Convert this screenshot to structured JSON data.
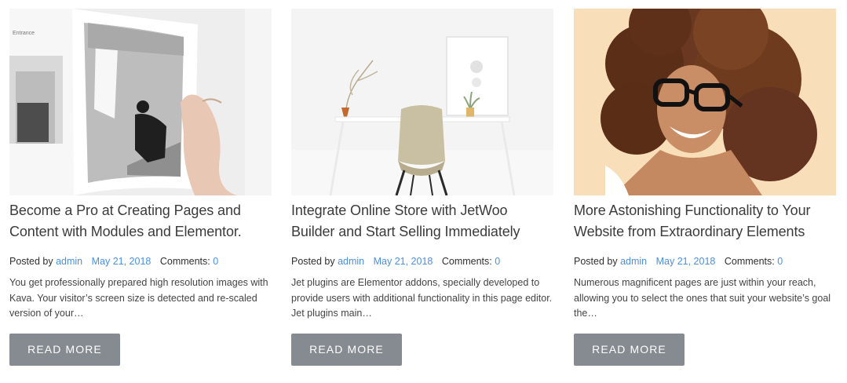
{
  "posts": [
    {
      "title": "Become a Pro at Creating Pages and Content with Modules and Elementor.",
      "posted_by_label": "Posted by",
      "author": "admin",
      "date": "May 21, 2018",
      "comments_label": "Comments:",
      "comments_count": "0",
      "excerpt": "You get professionally prepared high resolution images with Kava. Your visitor’s screen size is detected and re-scaled version of your…",
      "button_label": "READ MORE",
      "image_text": "Entrance"
    },
    {
      "title": "Integrate Online Store with JetWoo Builder and Start Selling Immediately",
      "posted_by_label": "Posted by",
      "author": "admin",
      "date": "May 21, 2018",
      "comments_label": "Comments:",
      "comments_count": "0",
      "excerpt": "Jet plugins are Elementor addons, specially developed to provide users with additional functionality in this page editor. Jet plugins main…",
      "button_label": "READ MORE"
    },
    {
      "title": "More Astonishing Functionality to Your Website from Extraordinary Elements",
      "posted_by_label": "Posted by",
      "author": "admin",
      "date": "May 21, 2018",
      "comments_label": "Comments:",
      "comments_count": "0",
      "excerpt": "Numerous magnificent pages are just within your reach, allowing you to select the ones that suit your website’s goal the…",
      "button_label": "READ MORE"
    }
  ],
  "colors": {
    "link": "#4a90e2",
    "button_bg": "#868b91",
    "button_text": "#ffffff",
    "title_text": "#3b3b3b"
  },
  "icons": [
    "magazine-photo",
    "desk-chair-photo",
    "curly-hair-woman-photo"
  ]
}
